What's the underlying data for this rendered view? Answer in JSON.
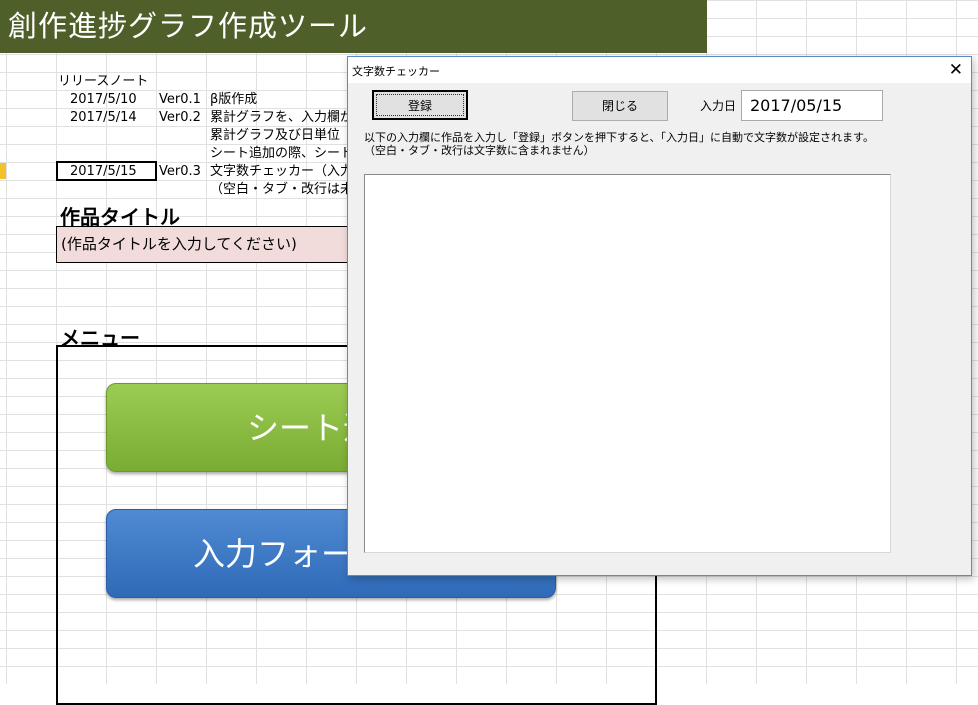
{
  "sheet": {
    "title": "創作進捗グラフ作成ツール",
    "release_notes": {
      "heading": "リリースノート",
      "rows": [
        {
          "date": "2017/5/10",
          "version": "Ver0.1",
          "text": "β版作成"
        },
        {
          "date": "2017/5/14",
          "version": "Ver0.2",
          "text": "累計グラフを、入力欄が"
        },
        {
          "date": "",
          "version": "",
          "text": "累計グラフ及び日単位"
        },
        {
          "date": "",
          "version": "",
          "text": "シート追加の際、シート"
        },
        {
          "date": "2017/5/15",
          "version": "Ver0.3",
          "text": "文字数チェッカー（入力"
        },
        {
          "date": "",
          "version": "",
          "text": "（空白・タブ・改行は未"
        }
      ]
    },
    "work_title_label": "作品タイトル",
    "work_title_value": "(作品タイトルを入力してください)",
    "menu_label": "メニュー",
    "menu_buttons": {
      "sheet_add": "シート追",
      "input_form": "入力フォー"
    }
  },
  "dialog": {
    "title": "文字数チェッカー",
    "close_glyph": "✕",
    "register_label": "登録",
    "close_label": "閉じる",
    "date_label": "入力日",
    "date_value": "2017/05/15",
    "instruction_1": "以下の入力欄に作品を入力し「登録」ボタンを押下すると、「入力日」に自動で文字数が設定されます。",
    "instruction_2": "（空白・タブ・改行は文字数に含まれません）",
    "textarea_value": ""
  },
  "colors": {
    "title_bar": "#4f5f2a",
    "title_input_bg": "#f2dcdb",
    "green_button": "#8cbf45",
    "blue_button": "#3b78c6",
    "dialog_border": "#5a8ac9"
  }
}
